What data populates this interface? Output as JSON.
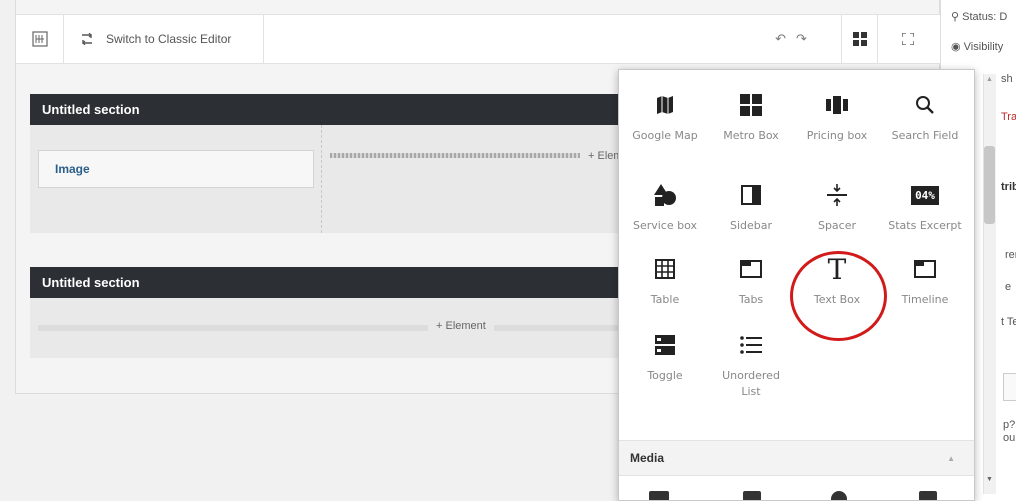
{
  "toolbar": {
    "switch_label": "Switch to Classic Editor",
    "undo_icon": "undo-icon",
    "redo_icon": "redo-icon",
    "layout_icon": "grid-icon",
    "fullscreen_icon": "fullscreen-icon"
  },
  "sections": [
    {
      "title": "Untitled section",
      "element": "Image",
      "add_label": "+ Elem"
    },
    {
      "title": "Untitled section",
      "add_label": "+ Element"
    }
  ],
  "sidebar": {
    "status": "Status: D",
    "visibility": "Visibility",
    "publish_fragment": "sh",
    "trash_fragment": "Tra",
    "attributes_fragment": "trib",
    "fragment_en": "ren",
    "fragment_e": "e",
    "fragment_te": "t Te",
    "fragment_p": "p?",
    "fragment_ou": "ou"
  },
  "picker": {
    "items": [
      {
        "label": "Google Map",
        "icon": "map-icon"
      },
      {
        "label": "Metro Box",
        "icon": "metro-grid-icon"
      },
      {
        "label": "Pricing box",
        "icon": "pricing-columns-icon"
      },
      {
        "label": "Search Field",
        "icon": "search-icon"
      },
      {
        "label": "Service box",
        "icon": "shapes-icon"
      },
      {
        "label": "Sidebar",
        "icon": "sidebar-icon"
      },
      {
        "label": "Spacer",
        "icon": "spacer-icon"
      },
      {
        "label": "Stats Excerpt",
        "icon": "counter-icon",
        "icon_text": "04%"
      },
      {
        "label": "Table",
        "icon": "table-icon"
      },
      {
        "label": "Tabs",
        "icon": "tabs-icon"
      },
      {
        "label": "Text Box",
        "icon": "text-icon",
        "icon_text": "T"
      },
      {
        "label": "Timeline",
        "icon": "timeline-icon"
      },
      {
        "label": "Toggle",
        "icon": "toggle-icon"
      },
      {
        "label": "Unordered List",
        "icon": "list-icon"
      }
    ],
    "category": "Media",
    "highlighted": "Text Box"
  },
  "colors": {
    "section_header": "#2c3035",
    "highlight_circle": "#d11b1b",
    "image_label": "#2b5f8a"
  }
}
